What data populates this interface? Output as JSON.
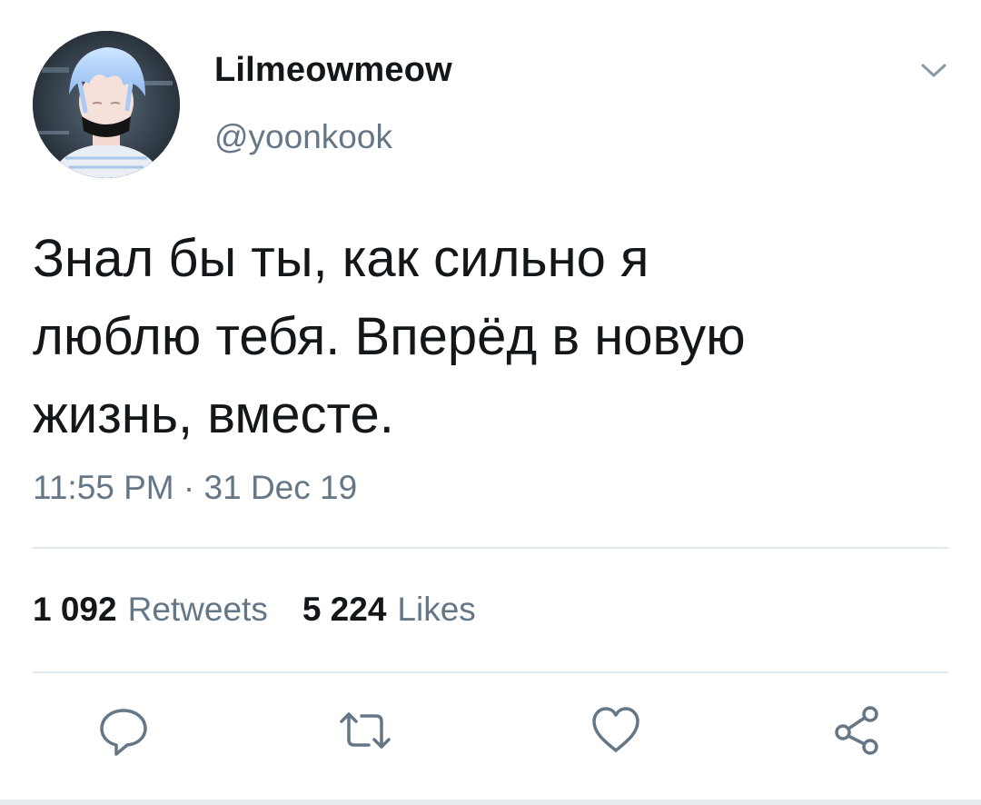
{
  "tweet": {
    "author": {
      "display_name": "Lilmeowmeow",
      "handle": "@yoonkook"
    },
    "text": "Знал бы ты, как сильно я\nлюблю тебя. Вперёд в новую\nжизнь, вместе.",
    "timestamp": "11:55 PM · 31 Dec 19",
    "stats": {
      "retweets_count": "1 092",
      "retweets_label": "Retweets",
      "likes_count": "5 224",
      "likes_label": "Likes"
    }
  },
  "icons": {
    "menu": "chevron-down-icon",
    "reply": "reply-icon",
    "retweet": "retweet-icon",
    "like": "heart-icon",
    "share": "share-icon"
  },
  "colors": {
    "primary_text": "#14171a",
    "secondary_text": "#657786",
    "divider": "#e1e8ed"
  }
}
